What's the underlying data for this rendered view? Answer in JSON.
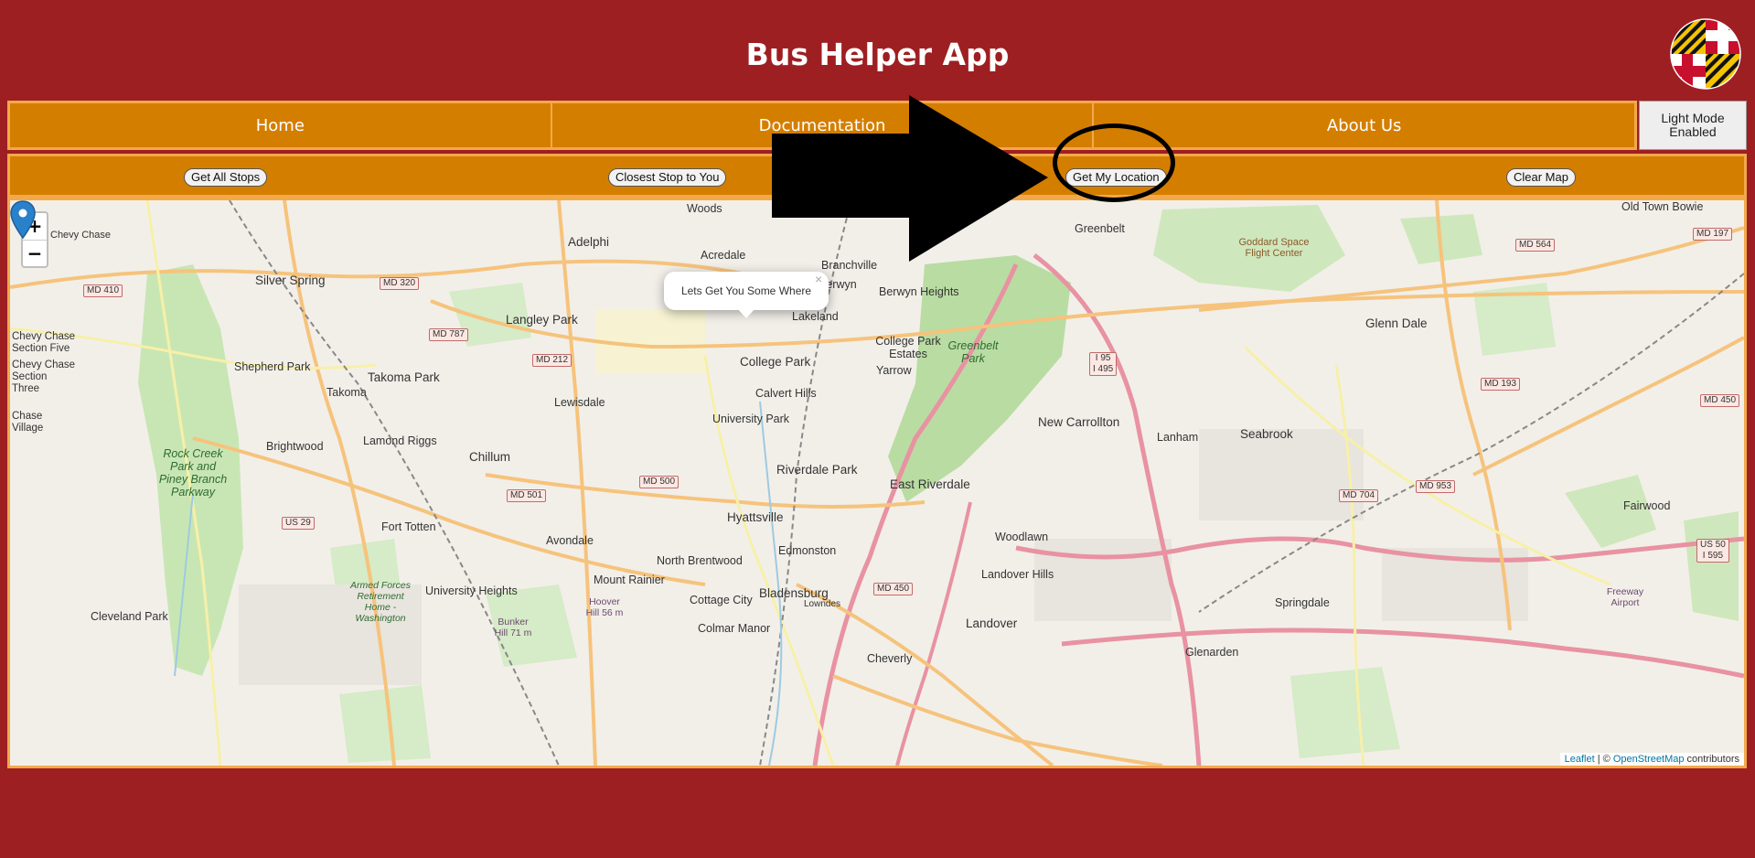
{
  "app": {
    "title": "Bus Helper App"
  },
  "nav": {
    "items": [
      {
        "label": "Home"
      },
      {
        "label": "Documentation"
      },
      {
        "label": "About Us"
      }
    ]
  },
  "mode_toggle": {
    "label": "Light Mode Enabled"
  },
  "toolbar": {
    "get_all_stops": "Get All Stops",
    "closest_stop": "Closest Stop to You",
    "get_my_location": "Get My Location",
    "clear_map": "Clear Map"
  },
  "map": {
    "zoom_in": "+",
    "zoom_out": "−",
    "popup_text": "Lets Get You Some Where",
    "popup_close": "×",
    "attribution": {
      "leaflet": "Leaflet",
      "separator": " | © ",
      "osm": "OpenStreetMap",
      "suffix": " contributors"
    },
    "labels": {
      "woods": "Woods",
      "old_town_bowie": "Old Town Bowie",
      "adelphi": "Adelphi",
      "acredale": "Acredale",
      "branchville": "Branchville",
      "greenbelt": "Greenbelt",
      "berwyn_heights": "Berwyn Heights",
      "berwyn": "Berwyn",
      "silver_spring": "Silver Spring",
      "langley_park": "Langley Park",
      "lakeland": "Lakeland",
      "college_park_estates": "College Park Estates",
      "greenbelt_park": "Greenbelt Park",
      "glenn_dale": "Glenn Dale",
      "chevy_chase_five": "Chevy Chase Section Five",
      "chevy_chase_three": "Chevy Chase Section Three",
      "shepherd_park": "Shepherd Park",
      "takoma_park": "Takoma Park",
      "takoma": "Takoma",
      "college_park": "College Park",
      "yarrow": "Yarrow",
      "calvert_hills": "Calvert Hills",
      "lewisdale": "Lewisdale",
      "university_park": "University Park",
      "new_carrollton": "New Carrollton",
      "lanham": "Lanham",
      "seabrook": "Seabrook",
      "brightwood": "Brightwood",
      "lamond_riggs": "Lamond Riggs",
      "chillum": "Chillum",
      "riverdale_park": "Riverdale Park",
      "east_riverdale": "East Riverdale",
      "rock_creek": "Rock Creek Park and Piney Branch Parkway",
      "fort_totten": "Fort Totten",
      "hyattsville": "Hyattsville",
      "avondale": "Avondale",
      "fairwood": "Fairwood",
      "edmonston": "Edmonston",
      "north_brentwood": "North Brentwood",
      "woodlawn": "Woodlawn",
      "landover_hills": "Landover Hills",
      "armed_forces": "Armed Forces Retirement Home - Washington",
      "university_heights": "University Heights",
      "mount_rainier": "Mount Rainier",
      "cottage_city": "Cottage City",
      "bladensburg": "Bladensburg",
      "springdale": "Springdale",
      "cleveland_park": "Cleveland Park",
      "hoover_hill": "Hoover Hill 56 m",
      "bunker_hill": "Bunker Hill 71 m",
      "colmar_manor": "Colmar Manor",
      "landover": "Landover",
      "glenarden": "Glenarden",
      "cheverly": "Cheverly",
      "freeway_airport": "Freeway Airport",
      "goddard": "Goddard Space Flight Center",
      "chase_village": "Chase Village",
      "chevy_chase": "Chevy Chase",
      "lowndes": "Lowndes"
    },
    "shields": {
      "md410": "MD 410",
      "md320": "MD 320",
      "md787": "MD 787",
      "md212": "MD 212",
      "md501": "MD 501",
      "md500": "MD 500",
      "us29": "US 29",
      "md450": "MD 450",
      "i95": "I 95\nI 495",
      "md564": "MD 564",
      "md197": "MD 197",
      "md193": "MD 193",
      "md450b": "MD 450",
      "md953": "MD 953",
      "md704": "MD 704",
      "us50": "US 50\nI 595"
    }
  },
  "colors": {
    "header_bg": "#9e1f22",
    "nav_bg": "#d47e00",
    "nav_border": "#f3a94a",
    "marker": "#2a81cb"
  }
}
